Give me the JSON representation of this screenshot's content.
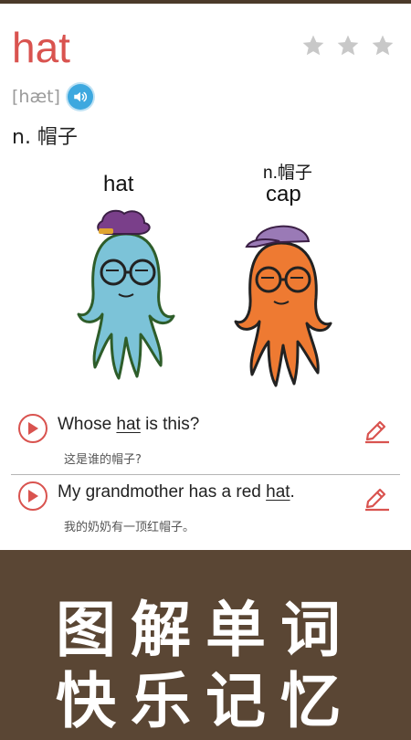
{
  "word": "hat",
  "rating": {
    "stars": 3,
    "filled": 0,
    "color": "#c8c8c8"
  },
  "phonetic": "[hæt]",
  "definition": "n. 帽子",
  "illustration": {
    "left_label": "hat",
    "right_definition": "n.帽子",
    "right_label": "cap"
  },
  "examples": [
    {
      "before": "Whose ",
      "keyword": "hat",
      "after": " is this?",
      "translation": "这是谁的帽子?"
    },
    {
      "before": "My grandmother has a red ",
      "keyword": "hat",
      "after": ".",
      "translation": "我的奶奶有一顶红帽子。"
    }
  ],
  "banner": {
    "line1": "图解单词",
    "line2": "快乐记忆"
  },
  "colors": {
    "accent": "#d9534f",
    "speaker": "#3da8df",
    "banner": "#5a4634"
  }
}
